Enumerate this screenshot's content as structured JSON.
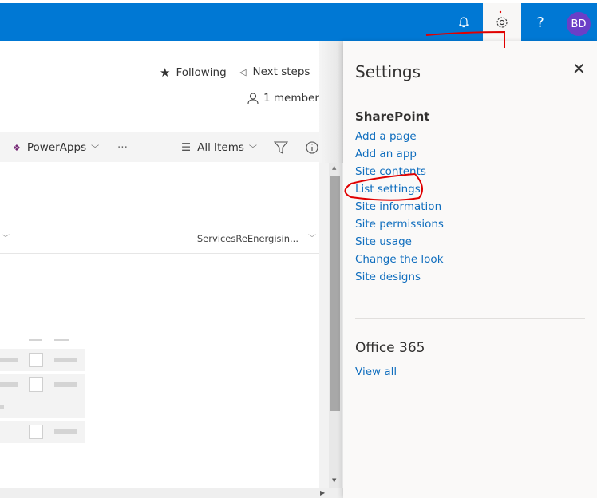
{
  "topbar": {
    "icons": [
      "bell-icon",
      "gear-icon",
      "help-icon"
    ],
    "help_glyph": "?",
    "avatar_initials": "BD",
    "brand_color": "#0078d4",
    "avatar_color": "#6b3fc7"
  },
  "site_header": {
    "following_label": "Following",
    "next_steps_label": "Next steps",
    "members_label": "1 member"
  },
  "command_bar": {
    "powerapps_label": "PowerApps",
    "more_label": "···",
    "view_label": "All Items"
  },
  "list": {
    "column_header": "ServicesReEnergisin..."
  },
  "settings_panel": {
    "title": "Settings",
    "sharepoint_section": {
      "title": "SharePoint",
      "links": [
        "Add a page",
        "Add an app",
        "Site contents",
        "List settings",
        "Site information",
        "Site permissions",
        "Site usage",
        "Change the look",
        "Site designs"
      ]
    },
    "office_section": {
      "title": "Office 365",
      "link": "View all"
    },
    "link_color": "#106ebe"
  },
  "annotations": {
    "color": "#e00000",
    "circled_item": "List settings"
  }
}
